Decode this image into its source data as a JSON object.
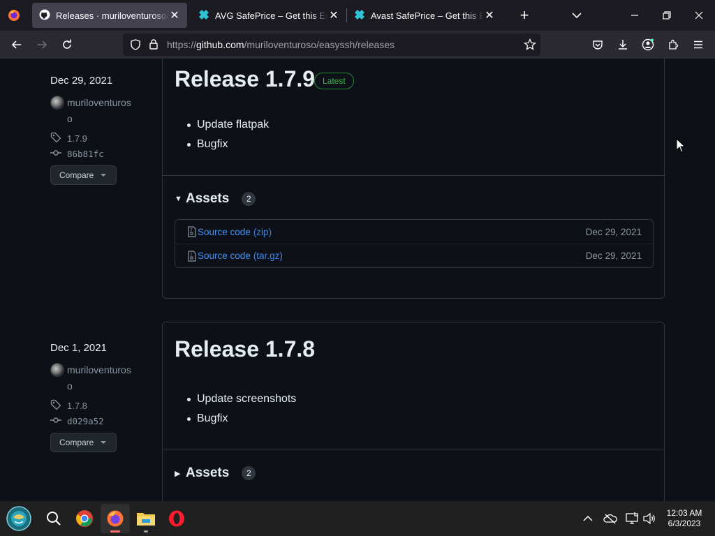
{
  "browser": {
    "tabs": [
      {
        "title": "Releases · muriloventuroso/easyssh",
        "active": true,
        "icon": "github-icon"
      },
      {
        "title": "AVG SafePrice – Get this Extension",
        "active": false,
        "icon": "avg-icon"
      },
      {
        "title": "Avast SafePrice – Get this Extension",
        "active": false,
        "icon": "avast-icon"
      }
    ],
    "url_prefix": "https://",
    "url_host": "github.com",
    "url_path": "/muriloventuroso/easyssh/releases"
  },
  "releases": [
    {
      "date": "Dec 29, 2021",
      "author_line1": "muriloventuros",
      "author_line2": "o",
      "tag": "1.7.9",
      "commit": "86b81fc",
      "compare_label": "Compare",
      "title": "Release 1.7.9",
      "badge": "Latest",
      "notes": [
        "Update flatpak",
        "Bugfix"
      ],
      "assets_label": "Assets",
      "assets_count": "2",
      "assets_expanded": true,
      "assets": [
        {
          "name": "Source code",
          "ext": "(zip)",
          "date": "Dec 29, 2021"
        },
        {
          "name": "Source code",
          "ext": "(tar.gz)",
          "date": "Dec 29, 2021"
        }
      ]
    },
    {
      "date": "Dec 1, 2021",
      "author_line1": "muriloventuros",
      "author_line2": "o",
      "tag": "1.7.8",
      "commit": "d029a52",
      "compare_label": "Compare",
      "title": "Release 1.7.8",
      "notes": [
        "Update screenshots",
        "Bugfix"
      ],
      "assets_label": "Assets",
      "assets_count": "2",
      "assets_expanded": false
    }
  ],
  "taskbar": {
    "time": "12:03 AM",
    "date": "6/3/2023",
    "apps": [
      "start-icon",
      "search-icon",
      "chrome-icon",
      "firefox-icon",
      "file-explorer-icon",
      "opera-icon"
    ]
  },
  "colors": {
    "accent_link": "#4493f8",
    "latest_green": "#3fb950",
    "page_bg": "#0d1117"
  }
}
